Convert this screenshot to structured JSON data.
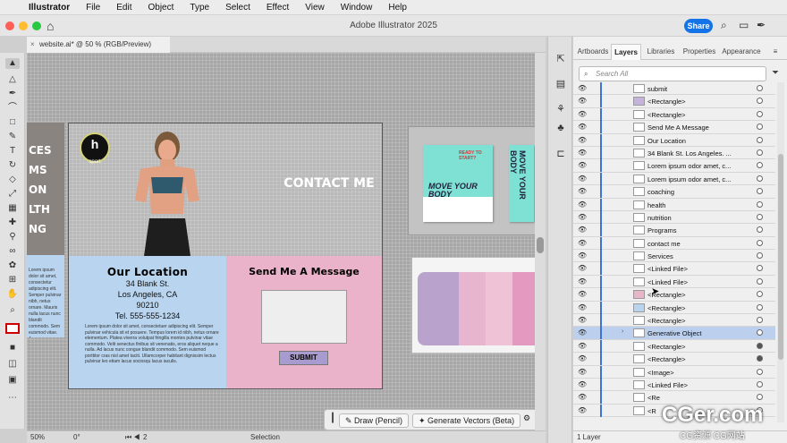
{
  "menubar": {
    "app": "Illustrator",
    "items": [
      "File",
      "Edit",
      "Object",
      "Type",
      "Select",
      "Effect",
      "View",
      "Window",
      "Help"
    ]
  },
  "title": "Adobe Illustrator 2025",
  "share": "Share",
  "doc_tab": "website.ai* @ 50 % (RGB/Preview)",
  "artboard": {
    "logo": "h",
    "logo_sub": "sport",
    "contact": "CONTACT ME",
    "location": {
      "heading": "Our Location",
      "lines": [
        "34 Blank St.",
        "Los Angeles, CA",
        "90210",
        "Tel. 555-555-1234"
      ],
      "lorem": "Lorem ipsum dolor sit amet, consectetuer adipiscing elit. Semper pulvinar vehicula sit et posuere. Tempus lorem id nibh, netus ornare elementum. Platea viverra volutpat fringilla montes pulvinar vitae commodo. Velit senectus finibus sit venenatis, eros aliquet neque a nulla. Ad lacus nunc congue blandit commodo. Sem euismod porttitor cras nisl amet taciti. Ullamcorper habitant dignissim lectus pulvinar leo etiam lacus sociosqu lacus iaculis."
    },
    "message": {
      "heading": "Send Me A Message",
      "submit": "SUBMIT"
    },
    "strip_words": [
      "CES",
      "MS",
      "ON",
      "LTH",
      "NG"
    ],
    "strip_text": "Lorem ipsum dolor sit amet, consectetur adipiscing elit. Semper pulvinar nibh, netus ornare. Mauris nulla lacus nunc blandit commodo. Sem euismod vitae. Arcu"
  },
  "brochure": {
    "headline": "MOVE YOUR BODY",
    "tag": "READY TO START?",
    "side": "MOVE YOUR BODY"
  },
  "swatches": [
    "#b9a3cd",
    "#e8b5cf",
    "#f0c2d6",
    "#e49ac0"
  ],
  "float_bar": {
    "pencil": "Draw (Pencil)",
    "vectors": "Generate Vectors (Beta)"
  },
  "status": {
    "zoom": "50%",
    "rotate": "0°",
    "page": "2",
    "tool": "Selection"
  },
  "panel": {
    "tabs": [
      "Artboards",
      "Layers",
      "Libraries",
      "Properties",
      "Appearance"
    ],
    "search": "Search All",
    "rows": [
      {
        "name": "submit",
        "target": "empty",
        "selected": false,
        "expand": false
      },
      {
        "name": "<Rectangle>",
        "target": "empty",
        "selected": false,
        "expand": false,
        "thumb": "#c3b3dd"
      },
      {
        "name": "<Rectangle>",
        "target": "empty",
        "selected": false,
        "expand": false
      },
      {
        "name": "Send Me A Message",
        "target": "empty",
        "selected": false,
        "expand": false
      },
      {
        "name": "Our Location",
        "target": "empty",
        "selected": false,
        "expand": false
      },
      {
        "name": "34 Blank St. Los Angeles. ...",
        "target": "empty",
        "selected": false,
        "expand": false
      },
      {
        "name": "Lorem ipsum odor amet, c...",
        "target": "empty",
        "selected": false,
        "expand": false
      },
      {
        "name": "Lorem ipsum odor amet, c...",
        "target": "empty",
        "selected": false,
        "expand": false
      },
      {
        "name": "coaching",
        "target": "empty",
        "selected": false,
        "expand": false
      },
      {
        "name": "health",
        "target": "empty",
        "selected": false,
        "expand": false
      },
      {
        "name": "nutrition",
        "target": "empty",
        "selected": false,
        "expand": false
      },
      {
        "name": "Programs",
        "target": "empty",
        "selected": false,
        "expand": false
      },
      {
        "name": "contact me",
        "target": "empty",
        "selected": false,
        "expand": false
      },
      {
        "name": "Services",
        "target": "empty",
        "selected": false,
        "expand": false
      },
      {
        "name": "<Linked File>",
        "target": "empty",
        "selected": false,
        "expand": false
      },
      {
        "name": "<Linked File>",
        "target": "empty",
        "selected": false,
        "expand": false
      },
      {
        "name": "<Rectangle>",
        "target": "empty",
        "selected": false,
        "expand": false,
        "thumb": "#eab4c8"
      },
      {
        "name": "<Rectangle>",
        "target": "empty",
        "selected": false,
        "expand": false,
        "thumb": "#b8d4ee"
      },
      {
        "name": "<Rectangle>",
        "target": "empty",
        "selected": false,
        "expand": false
      },
      {
        "name": "Generative Object",
        "target": "empty",
        "selected": true,
        "expand": true
      },
      {
        "name": "<Rectangle>",
        "target": "filled",
        "selected": false,
        "expand": false
      },
      {
        "name": "<Rectangle>",
        "target": "filled",
        "selected": false,
        "expand": false
      },
      {
        "name": "<Image>",
        "target": "empty",
        "selected": false,
        "expand": false
      },
      {
        "name": "<Linked File>",
        "target": "empty",
        "selected": false,
        "expand": false
      },
      {
        "name": "<Re",
        "target": "empty",
        "selected": false,
        "expand": false
      },
      {
        "name": "<R",
        "target": "empty",
        "selected": false,
        "expand": false
      }
    ],
    "footer": "1 Layer"
  },
  "watermark": {
    "big": "CGer.com",
    "small": "CG资源 CG网站"
  },
  "colors": {
    "accent": "#1473e6",
    "selection": "#bcd0ee",
    "layer_bar": "#3c73d6"
  }
}
